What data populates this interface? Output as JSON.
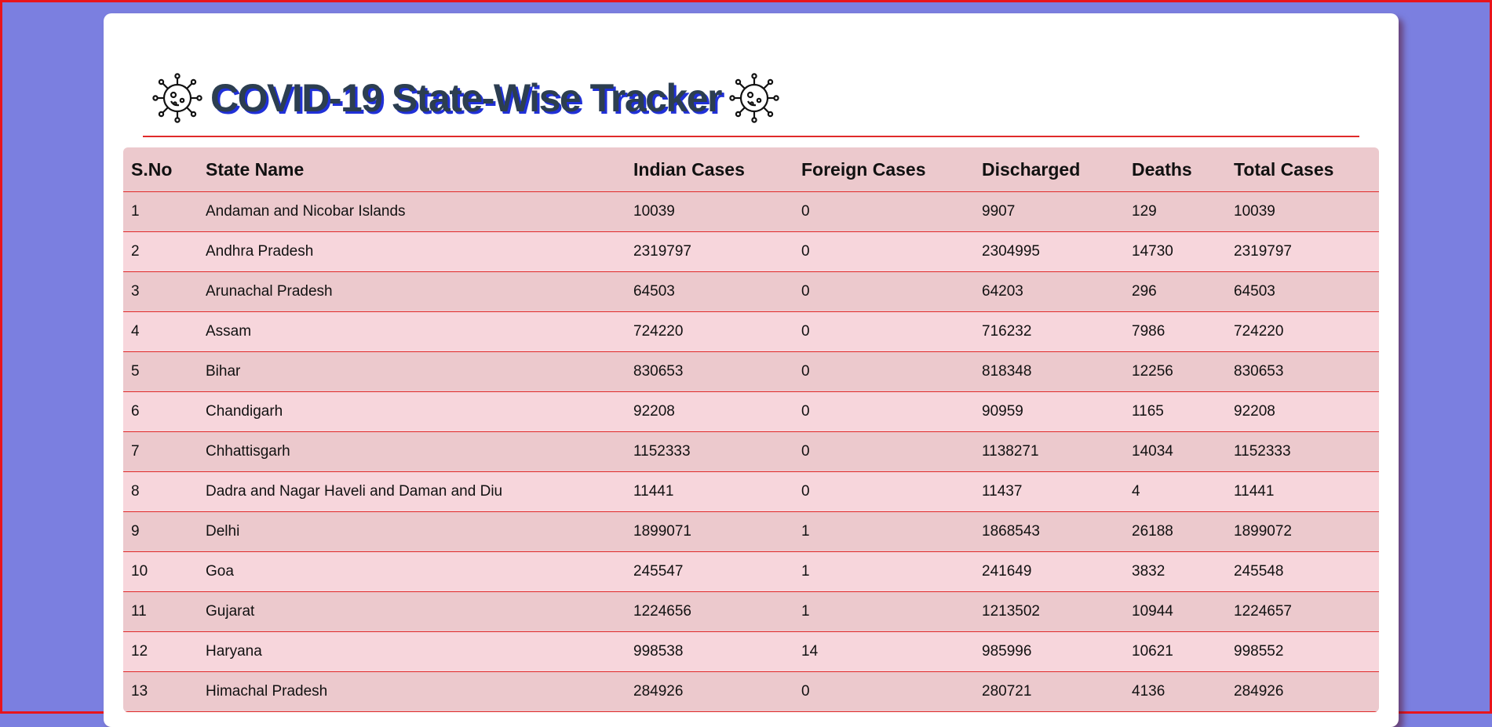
{
  "page": {
    "title": "COVID-19 State-Wise Tracker"
  },
  "colors": {
    "background": "#7b7fe0",
    "frame_border": "#e8141c",
    "card": "#ffffff",
    "title_text": "#2c3e50",
    "title_shadow": "#2030d8",
    "row_odd": "#ecc9cd",
    "row_even": "#f7d6dc",
    "row_divider": "#e02a2a"
  },
  "icons": {
    "left": "virus-icon",
    "right": "virus-icon"
  },
  "table": {
    "columns": [
      "S.No",
      "State Name",
      "Indian Cases",
      "Foreign Cases",
      "Discharged",
      "Deaths",
      "Total Cases"
    ],
    "rows": [
      [
        "1",
        "Andaman and Nicobar Islands",
        "10039",
        "0",
        "9907",
        "129",
        "10039"
      ],
      [
        "2",
        "Andhra Pradesh",
        "2319797",
        "0",
        "2304995",
        "14730",
        "2319797"
      ],
      [
        "3",
        "Arunachal Pradesh",
        "64503",
        "0",
        "64203",
        "296",
        "64503"
      ],
      [
        "4",
        "Assam",
        "724220",
        "0",
        "716232",
        "7986",
        "724220"
      ],
      [
        "5",
        "Bihar",
        "830653",
        "0",
        "818348",
        "12256",
        "830653"
      ],
      [
        "6",
        "Chandigarh",
        "92208",
        "0",
        "90959",
        "1165",
        "92208"
      ],
      [
        "7",
        "Chhattisgarh",
        "1152333",
        "0",
        "1138271",
        "14034",
        "1152333"
      ],
      [
        "8",
        "Dadra and Nagar Haveli and Daman and Diu",
        "11441",
        "0",
        "11437",
        "4",
        "11441"
      ],
      [
        "9",
        "Delhi",
        "1899071",
        "1",
        "1868543",
        "26188",
        "1899072"
      ],
      [
        "10",
        "Goa",
        "245547",
        "1",
        "241649",
        "3832",
        "245548"
      ],
      [
        "11",
        "Gujarat",
        "1224656",
        "1",
        "1213502",
        "10944",
        "1224657"
      ],
      [
        "12",
        "Haryana",
        "998538",
        "14",
        "985996",
        "10621",
        "998552"
      ],
      [
        "13",
        "Himachal Pradesh",
        "284926",
        "0",
        "280721",
        "4136",
        "284926"
      ]
    ]
  }
}
